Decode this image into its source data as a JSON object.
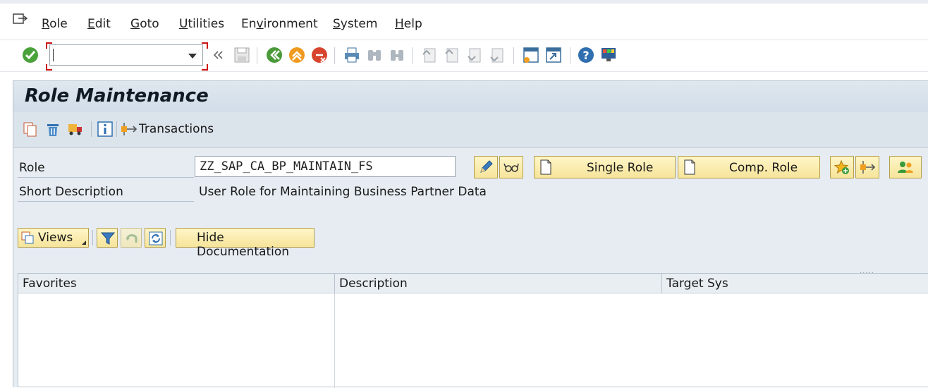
{
  "menu": {
    "items": [
      {
        "id": "role",
        "label": "Role"
      },
      {
        "id": "edit",
        "label": "Edit"
      },
      {
        "id": "goto",
        "label": "Goto"
      },
      {
        "id": "utilities",
        "label": "Utilities"
      },
      {
        "id": "environment",
        "label": "Environment"
      },
      {
        "id": "system",
        "label": "System"
      },
      {
        "id": "help",
        "label": "Help"
      }
    ]
  },
  "toolbar": {
    "command_field_value": "",
    "icons": [
      "enter-icon",
      "back-icon",
      "exit-icon",
      "cancel-icon",
      "print-icon",
      "find-icon",
      "find-next-icon",
      "first-page-icon",
      "previous-page-icon",
      "next-page-icon",
      "last-page-icon",
      "new-session-icon",
      "shortcut-icon",
      "help-icon",
      "customize-layout-icon"
    ]
  },
  "page": {
    "title": "Role Maintenance",
    "app_toolbar": {
      "transactions_label": "Transactions"
    },
    "role_label": "Role",
    "role_value": "ZZ_SAP_CA_BP_MAINTAIN_FS",
    "short_description_label": "Short Description",
    "short_description_value": "User Role for Maintaining Business Partner Data",
    "single_role_label": "Single Role",
    "comp_role_label": "Comp. Role",
    "views_label": "Views",
    "hide_documentation_label": "Hide Documentation"
  },
  "grid": {
    "columns": [
      "Favorites",
      "Description",
      "Target Sys"
    ]
  },
  "colors": {
    "accent_yellow": "#f6e49a",
    "panel_bg": "#e6ecf2",
    "command_field_border": "#cc1111"
  }
}
